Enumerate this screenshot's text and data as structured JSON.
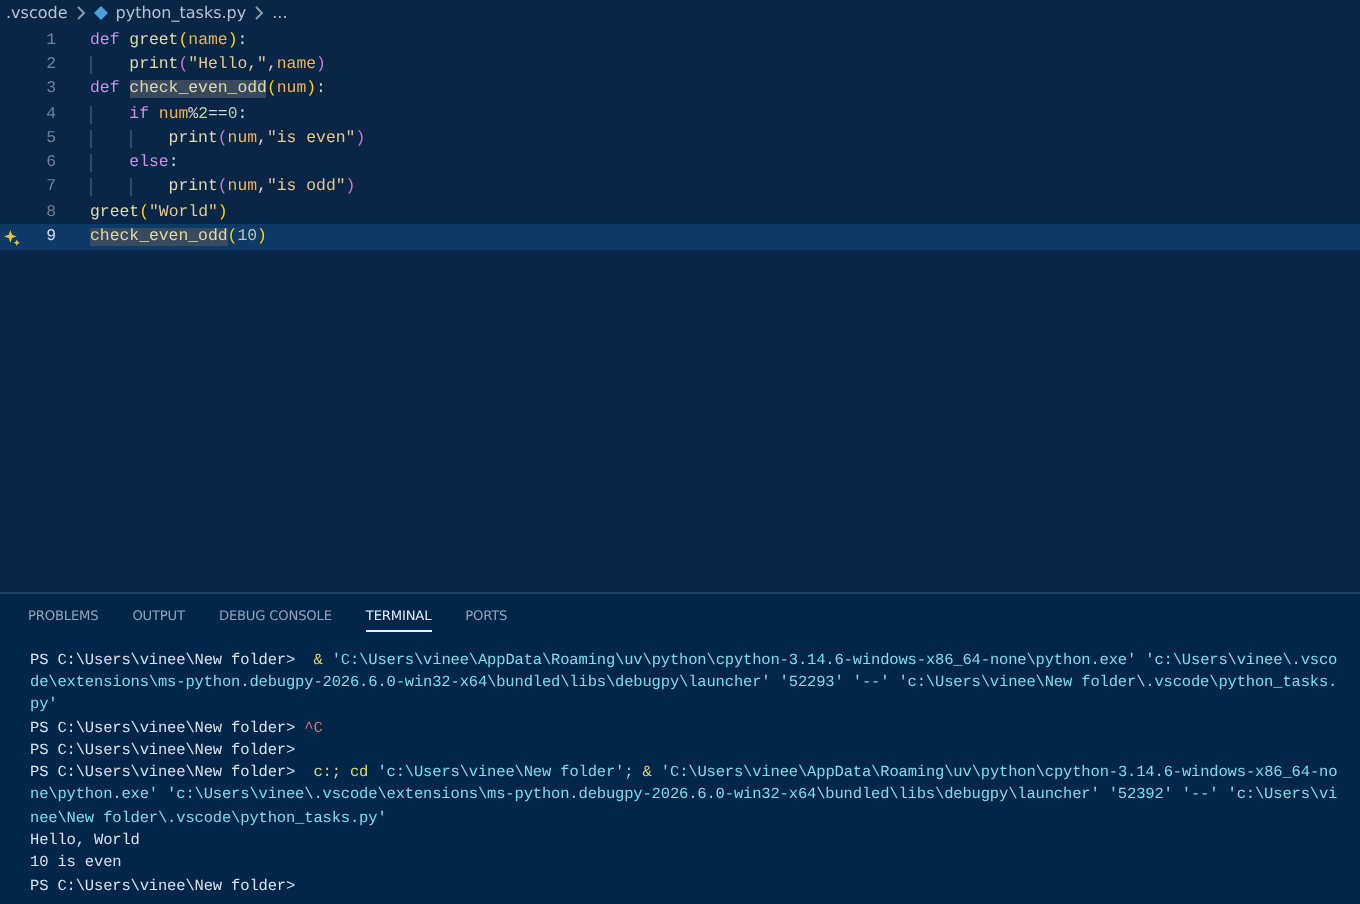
{
  "breadcrumb": [
    {
      "text": ".vscode",
      "kind": "folder"
    },
    {
      "text": "python_tasks.py",
      "kind": "file"
    },
    {
      "text": "...",
      "kind": "more"
    }
  ],
  "editor": {
    "lines": [
      {
        "number": "1",
        "current": false,
        "lightbulb": false,
        "tokens": [
          {
            "t": "def ",
            "kind": "keyword"
          },
          {
            "t": "greet",
            "kind": "func"
          },
          {
            "t": "(",
            "kind": "paren"
          },
          {
            "t": "name",
            "kind": "var"
          },
          {
            "t": ")",
            "kind": "paren"
          },
          {
            "t": ":",
            "kind": "plain"
          }
        ]
      },
      {
        "number": "2",
        "current": false,
        "lightbulb": false,
        "tokens": [
          {
            "t": "    print",
            "kind": "func"
          },
          {
            "t": "(",
            "kind": "paren2"
          },
          {
            "t": "\"Hello,\"",
            "kind": "string"
          },
          {
            "t": ",",
            "kind": "plain"
          },
          {
            "t": "name",
            "kind": "var"
          },
          {
            "t": ")",
            "kind": "paren2"
          }
        ]
      },
      {
        "number": "3",
        "current": false,
        "lightbulb": false,
        "tokens": [
          {
            "t": "def ",
            "kind": "keyword"
          },
          {
            "t": "check_even_odd",
            "kind": "highlighted"
          },
          {
            "t": "(",
            "kind": "paren"
          },
          {
            "t": "num",
            "kind": "var"
          },
          {
            "t": ")",
            "kind": "paren"
          },
          {
            "t": ":",
            "kind": "plain"
          }
        ]
      },
      {
        "number": "4",
        "current": false,
        "lightbulb": false,
        "tokens": [
          {
            "t": "    if ",
            "kind": "keyword"
          },
          {
            "t": "num",
            "kind": "var"
          },
          {
            "t": "%",
            "kind": "operator"
          },
          {
            "t": "2",
            "kind": "number"
          },
          {
            "t": "==",
            "kind": "plain"
          },
          {
            "t": "0",
            "kind": "number"
          },
          {
            "t": ":",
            "kind": "plain"
          }
        ]
      },
      {
        "number": "5",
        "current": false,
        "lightbulb": false,
        "tokens": [
          {
            "t": "        print",
            "kind": "func"
          },
          {
            "t": "(",
            "kind": "paren2"
          },
          {
            "t": "num",
            "kind": "var"
          },
          {
            "t": ",",
            "kind": "plain"
          },
          {
            "t": "\"is even\"",
            "kind": "string"
          },
          {
            "t": ")",
            "kind": "paren2"
          }
        ]
      },
      {
        "number": "6",
        "current": false,
        "lightbulb": false,
        "tokens": [
          {
            "t": "    else",
            "kind": "keyword"
          },
          {
            "t": ":",
            "kind": "plain"
          }
        ]
      },
      {
        "number": "7",
        "current": false,
        "lightbulb": false,
        "tokens": [
          {
            "t": "        print",
            "kind": "func"
          },
          {
            "t": "(",
            "kind": "paren2"
          },
          {
            "t": "num",
            "kind": "var"
          },
          {
            "t": ",",
            "kind": "plain"
          },
          {
            "t": "\"is odd\"",
            "kind": "string"
          },
          {
            "t": ")",
            "kind": "paren2"
          }
        ]
      },
      {
        "number": "8",
        "current": false,
        "lightbulb": false,
        "tokens": [
          {
            "t": "greet",
            "kind": "func"
          },
          {
            "t": "(",
            "kind": "paren"
          },
          {
            "t": "\"World\"",
            "kind": "string"
          },
          {
            "t": ")",
            "kind": "paren"
          }
        ]
      },
      {
        "number": "9",
        "current": true,
        "lightbulb": true,
        "tokens": [
          {
            "t": "check_even_odd",
            "kind": "highlighted"
          },
          {
            "t": "(",
            "kind": "paren"
          },
          {
            "t": "10",
            "kind": "number"
          },
          {
            "t": ")",
            "kind": "paren"
          }
        ]
      }
    ]
  },
  "panel_tabs": [
    {
      "label": "PROBLEMS",
      "selected": false
    },
    {
      "label": "OUTPUT",
      "selected": false
    },
    {
      "label": "DEBUG CONSOLE",
      "selected": false
    },
    {
      "label": "TERMINAL",
      "selected": true
    },
    {
      "label": "PORTS",
      "selected": false
    }
  ],
  "terminal": [
    [
      {
        "t": "PS C:\\Users\\vinee\\New folder> ",
        "kind": "plain"
      },
      {
        "t": " & ",
        "kind": "command"
      },
      {
        "t": "'C:\\Users\\vinee\\AppData\\Roaming\\uv\\python\\cpython-3.14.6-windows-x86_64-none\\python.exe' 'c:\\Users\\vinee\\.vsco",
        "kind": "arg"
      }
    ],
    [
      {
        "t": "de\\extensions\\ms-python.debugpy-2026.6.0-win32-x64\\bundled\\libs\\debugpy\\launcher' '52293' '--' 'c:\\Users\\vinee\\New folder\\.vscode\\python_tasks.",
        "kind": "arg"
      }
    ],
    [
      {
        "t": "py'",
        "kind": "arg"
      }
    ],
    [
      {
        "t": "PS C:\\Users\\vinee\\New folder> ",
        "kind": "plain"
      },
      {
        "t": "^C",
        "kind": "error"
      }
    ],
    [
      {
        "t": "PS C:\\Users\\vinee\\New folder>",
        "kind": "plain"
      }
    ],
    [
      {
        "t": "PS C:\\Users\\vinee\\New folder> ",
        "kind": "plain"
      },
      {
        "t": " c:; cd ",
        "kind": "command"
      },
      {
        "t": "'c:\\Users\\vinee\\New folder'; ",
        "kind": "arg"
      },
      {
        "t": "& ",
        "kind": "command"
      },
      {
        "t": "'C:\\Users\\vinee\\AppData\\Roaming\\uv\\python\\cpython-3.14.6-windows-x86_64-no",
        "kind": "arg"
      }
    ],
    [
      {
        "t": "ne\\python.exe' 'c:\\Users\\vinee\\.vscode\\extensions\\ms-python.debugpy-2026.6.0-win32-x64\\bundled\\libs\\debugpy\\launcher' '52392' '--' 'c:\\Users\\vi",
        "kind": "arg"
      }
    ],
    [
      {
        "t": "nee\\New folder\\.vscode\\python_tasks.py'",
        "kind": "arg"
      }
    ],
    [
      {
        "t": "Hello, World",
        "kind": "plain"
      }
    ],
    [
      {
        "t": "10 is even",
        "kind": "plain"
      }
    ],
    [
      {
        "t": "PS C:\\Users\\vinee\\New folder>",
        "kind": "plain"
      }
    ]
  ]
}
